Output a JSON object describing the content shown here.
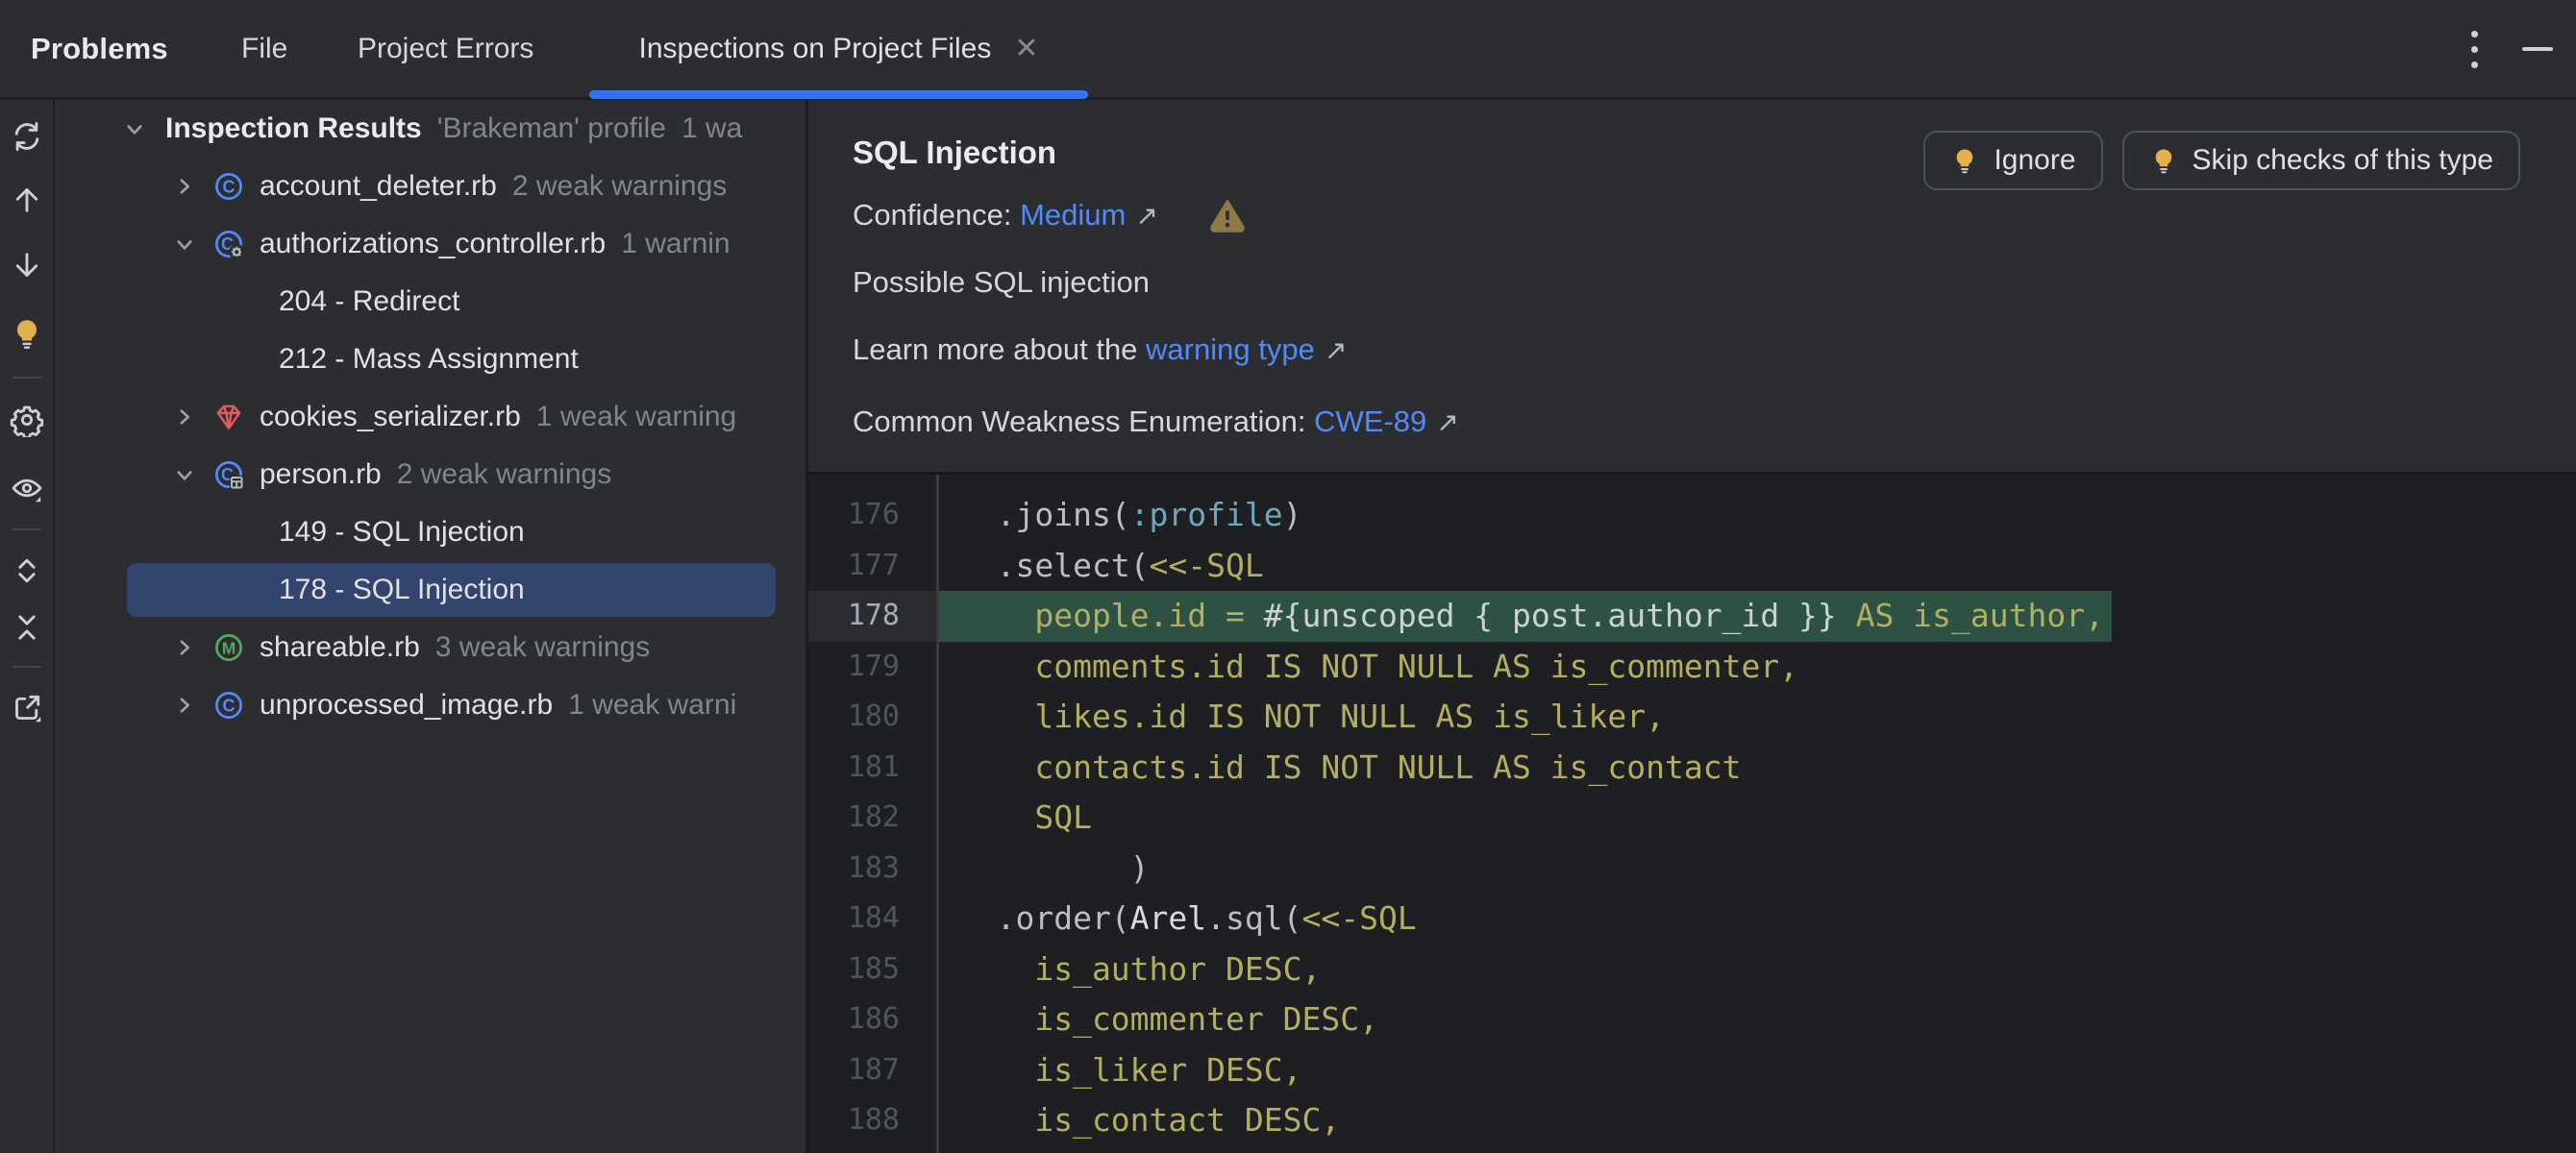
{
  "header": {
    "title": "Problems",
    "tabs": [
      {
        "label": "File"
      },
      {
        "label": "Project Errors"
      },
      {
        "label": "Inspections on Project Files",
        "active": true,
        "close_glyph": "✕"
      }
    ]
  },
  "window_controls": {
    "more_icon": "kebab-vertical",
    "minimize_icon": "minimize-dash"
  },
  "toolbar": {
    "items": [
      "refresh",
      "arrow-up",
      "arrow-down",
      "quick-fix-bulb",
      "divider",
      "settings-gear",
      "preview-eye",
      "divider",
      "expand-all",
      "collapse-all",
      "divider",
      "open-in-editor"
    ]
  },
  "tree": {
    "rows": [
      {
        "level": 0,
        "expanded": true,
        "bold": true,
        "label": "Inspection Results",
        "suffix": "'Brakeman' profile",
        "count": "1 wa"
      },
      {
        "level": 1,
        "expanded": false,
        "icon": "ruby-class",
        "label": "account_deleter.rb",
        "count": "2 weak warnings"
      },
      {
        "level": 1,
        "expanded": true,
        "icon": "rails-controller",
        "label": "authorizations_controller.rb",
        "count": "1 warnin"
      },
      {
        "level": 2,
        "label": "204 - Redirect"
      },
      {
        "level": 2,
        "label": "212 - Mass Assignment"
      },
      {
        "level": 1,
        "expanded": false,
        "icon": "ruby-gem",
        "label": "cookies_serializer.rb",
        "count": "1 weak warning"
      },
      {
        "level": 1,
        "expanded": true,
        "icon": "rails-model",
        "label": "person.rb",
        "count": "2 weak warnings"
      },
      {
        "level": 2,
        "label": "149 - SQL Injection"
      },
      {
        "level": 2,
        "label": "178 - SQL Injection",
        "selected": true
      },
      {
        "level": 1,
        "expanded": false,
        "icon": "ruby-module",
        "label": "shareable.rb",
        "count": "3 weak warnings"
      },
      {
        "level": 1,
        "expanded": false,
        "icon": "ruby-class",
        "label": "unprocessed_image.rb",
        "count": "1 weak warni"
      }
    ]
  },
  "details": {
    "title": "SQL Injection",
    "confidence_label": "Confidence: ",
    "confidence_value": "Medium",
    "external_arrow": "↗",
    "message": "Possible SQL injection",
    "learn_prefix": "Learn more about the ",
    "learn_link": "warning type",
    "cwe_label": "Common Weakness Enumeration: ",
    "cwe_link": "CWE-89"
  },
  "actions": {
    "ignore_label": "Ignore",
    "skip_label": "Skip checks of this type"
  },
  "code": {
    "lines": [
      {
        "num": "176",
        "tokens": [
          {
            "t": "   .joins(",
            "c": "plain"
          },
          {
            "t": ":profile",
            "c": "symbol"
          },
          {
            "t": ")",
            "c": "plain"
          }
        ]
      },
      {
        "num": "177",
        "tokens": [
          {
            "t": "   .select(",
            "c": "plain"
          },
          {
            "t": "<<-SQL",
            "c": "sql"
          }
        ]
      },
      {
        "num": "178",
        "highlighted": true,
        "tokens": [
          {
            "t": "     people.id = ",
            "c": "sql"
          },
          {
            "t": "#{unscoped { post.author_id }}",
            "c": "interp"
          },
          {
            "t": " AS is_author,",
            "c": "sql"
          }
        ]
      },
      {
        "num": "179",
        "tokens": [
          {
            "t": "     comments.id IS NOT NULL AS is_commenter,",
            "c": "sql"
          }
        ]
      },
      {
        "num": "180",
        "tokens": [
          {
            "t": "     likes.id IS NOT NULL AS is_liker,",
            "c": "sql"
          }
        ]
      },
      {
        "num": "181",
        "tokens": [
          {
            "t": "     contacts.id IS NOT NULL AS is_contact",
            "c": "sql"
          }
        ]
      },
      {
        "num": "182",
        "tokens": [
          {
            "t": "     SQL",
            "c": "sql"
          }
        ]
      },
      {
        "num": "183",
        "tokens": [
          {
            "t": "          )",
            "c": "plain"
          }
        ]
      },
      {
        "num": "184",
        "tokens": [
          {
            "t": "   .order(",
            "c": "plain"
          },
          {
            "t": "Arel",
            "c": "class"
          },
          {
            "t": ".sql(",
            "c": "plain"
          },
          {
            "t": "<<-SQL",
            "c": "sql"
          }
        ]
      },
      {
        "num": "185",
        "tokens": [
          {
            "t": "     is_author DESC,",
            "c": "sql"
          }
        ]
      },
      {
        "num": "186",
        "tokens": [
          {
            "t": "     is_commenter DESC,",
            "c": "sql"
          }
        ]
      },
      {
        "num": "187",
        "tokens": [
          {
            "t": "     is_liker DESC,",
            "c": "sql"
          }
        ]
      },
      {
        "num": "188",
        "tokens": [
          {
            "t": "     is_contact DESC,",
            "c": "sql"
          }
        ]
      }
    ]
  },
  "colors": {
    "panel_bg": "#2B2D30",
    "editor_bg": "#1E1F22",
    "accent_blue": "#3574F0",
    "link_blue": "#548AF7",
    "selection_blue": "#33456F",
    "warning_highlight_green": "#2D5243",
    "sql_string_yellow": "#B3AE60",
    "bulb_gold": "#E3B04C",
    "warning_triangle": "#8F7A45",
    "ruby_red": "#DC5B5B",
    "class_icon_blue": "#548AF7",
    "module_icon_green": "#57A85C"
  }
}
